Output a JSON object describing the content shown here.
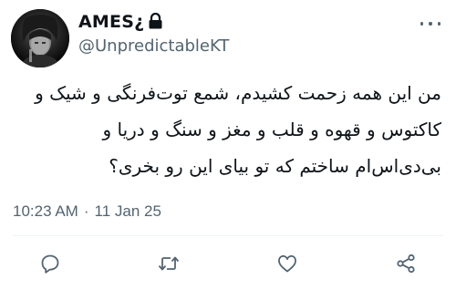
{
  "tweet": {
    "display_name": "AMES¿",
    "handle": "@UnpredictableKT",
    "body": "من این همه زحمت کشیدم، شمع توت‌فرنگی و شیک و کاکتوس و قهوه و قلب و مغز و سنگ و دریا و بی‌دی‌اس‌ام ساختم که تو بیای این رو بخری؟",
    "time": "10:23 AM",
    "separator": "·",
    "date": "11 Jan 25"
  },
  "icons": {
    "lock": "lock-icon",
    "more": "more-icon",
    "reply": "reply-icon",
    "retweet": "retweet-icon",
    "like": "heart-icon",
    "share": "share-icon"
  },
  "colors": {
    "text": "#0f1419",
    "secondary": "#536471",
    "divider": "#eff3f4",
    "background": "#ffffff"
  }
}
